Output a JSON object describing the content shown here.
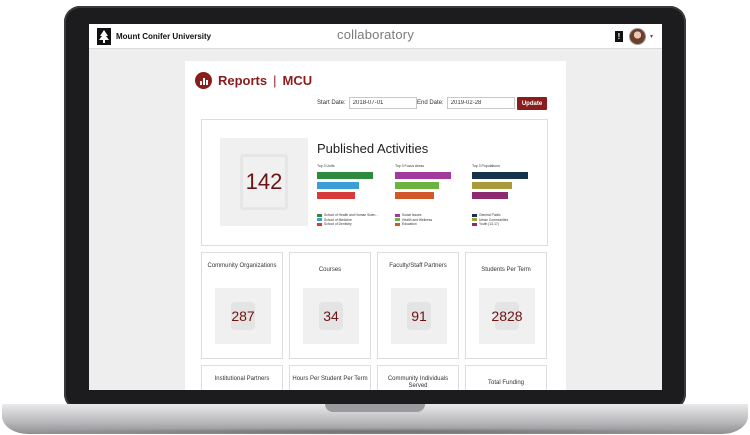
{
  "header": {
    "university": "Mount Conifer University",
    "app_logo": "collaboratory",
    "notification_icon": "exclamation-icon",
    "notification_symbol": "!",
    "dropdown_symbol": "▾"
  },
  "report": {
    "title": "Reports",
    "separator": "|",
    "org": "MCU",
    "start_label": "Start Date:",
    "start_value": "2018-07-01",
    "end_label": "End Date:",
    "end_value": "2019-02-28",
    "update_label": "Update"
  },
  "published": {
    "count": "142",
    "title": "Published Activities",
    "columns": [
      {
        "label": "Top 3 Units",
        "bars": [
          {
            "color": "#2e8b3e",
            "fraction": 1.0
          },
          {
            "color": "#3a9fd6",
            "fraction": 0.75
          },
          {
            "color": "#d63a3a",
            "fraction": 0.68
          }
        ],
        "legend": [
          "School of Health and Human Scien...",
          "School of Medicine",
          "School of Dentistry"
        ]
      },
      {
        "label": "Top 3 Focus Areas",
        "bars": [
          {
            "color": "#a23a9e",
            "fraction": 1.0
          },
          {
            "color": "#6cb33f",
            "fraction": 0.78
          },
          {
            "color": "#d0582a",
            "fraction": 0.7
          }
        ],
        "legend": [
          "Social Issues",
          "Health and Wellness",
          "Education"
        ]
      },
      {
        "label": "Top 3 Populations",
        "bars": [
          {
            "color": "#17324d",
            "fraction": 1.0
          },
          {
            "color": "#a99a3a",
            "fraction": 0.72
          },
          {
            "color": "#8e2a6e",
            "fraction": 0.65
          }
        ],
        "legend": [
          "General Public",
          "Urban Communities",
          "Youth (13-17)"
        ]
      }
    ]
  },
  "stats": [
    {
      "label": "Community Organizations",
      "value": "287"
    },
    {
      "label": "Courses",
      "value": "34"
    },
    {
      "label": "Faculty/Staff Partners",
      "value": "91"
    },
    {
      "label": "Students Per Term",
      "value": "2828"
    }
  ],
  "stats_row2": [
    {
      "label": "Institutional Partners"
    },
    {
      "label": "Hours Per Student Per Term"
    },
    {
      "label": "Community Individuals Served"
    },
    {
      "label": "Total Funding"
    }
  ],
  "colors": {
    "accent": "#8a1c1c",
    "number": "#6b1414"
  }
}
